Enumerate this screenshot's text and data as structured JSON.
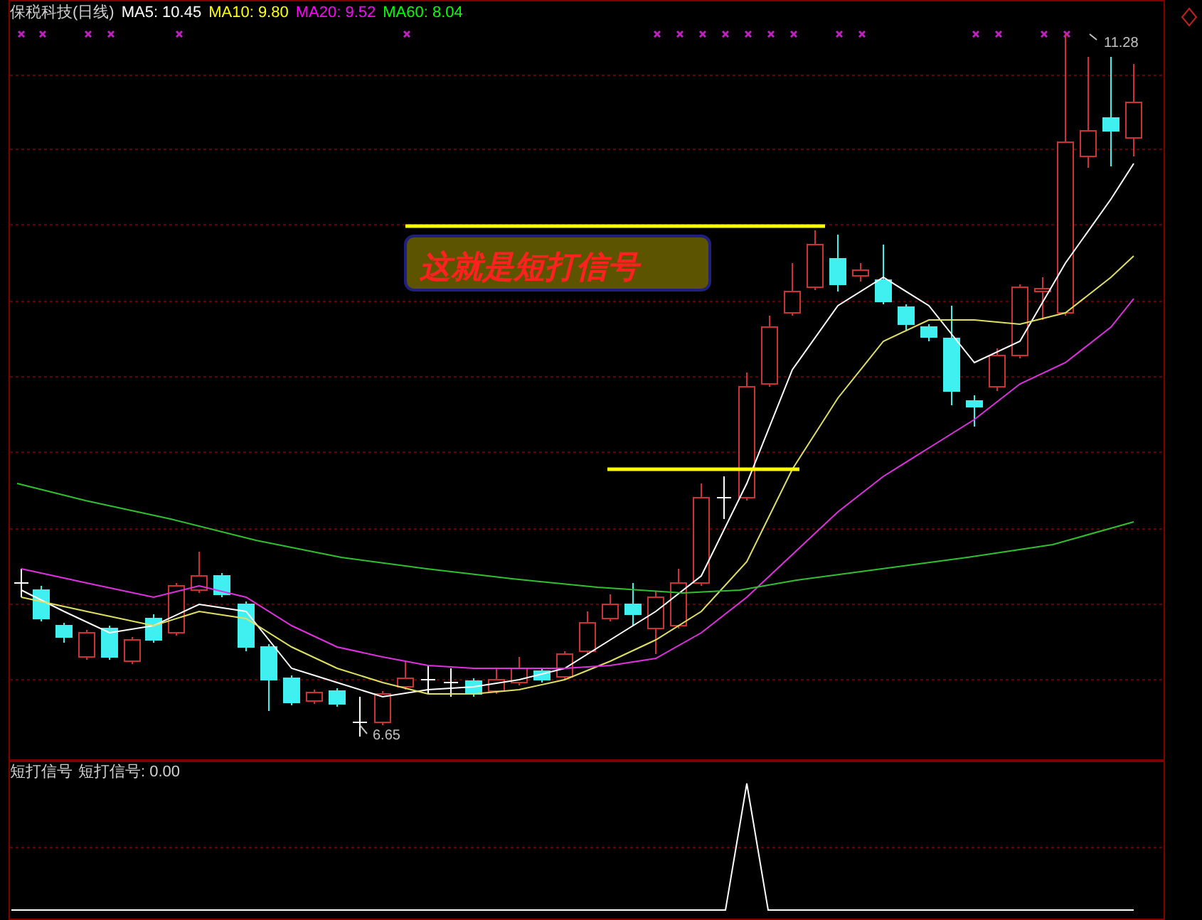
{
  "header": {
    "title": "保税科技(日线)",
    "indicators": [
      {
        "label": "MA5: 10.45",
        "color": "#ffffff"
      },
      {
        "label": "MA10: 9.80",
        "color": "#ffff00"
      },
      {
        "label": "MA20: 9.52",
        "color": "#ff00ff"
      },
      {
        "label": "MA60: 8.04",
        "color": "#00ff00"
      }
    ]
  },
  "main_chart": {
    "callout": "这就是短打信号",
    "high_label": "11.28",
    "low_label": "6.65"
  },
  "sub_chart": {
    "title": "短打信号",
    "reading": "短打信号: 0.00"
  }
}
